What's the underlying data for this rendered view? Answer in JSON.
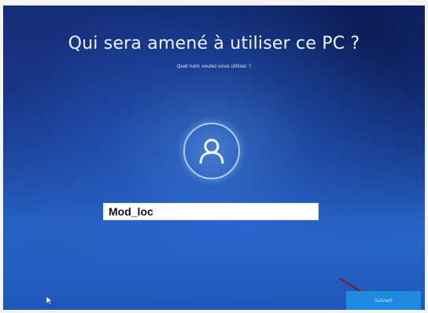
{
  "setup": {
    "title": "Qui sera amené à utiliser ce PC ?",
    "subtitle": "Quel nom voulez-vous utiliser ?",
    "username_value": "Mod_loc",
    "next_label": "Suivant"
  },
  "icons": {
    "avatar": "user-icon",
    "annotation": "red-arrow-icon",
    "pointer": "mouse-cursor-icon"
  },
  "colors": {
    "background": "#1f4fb0",
    "button": "#1e8be0",
    "annotation": "#8b1a1a"
  }
}
